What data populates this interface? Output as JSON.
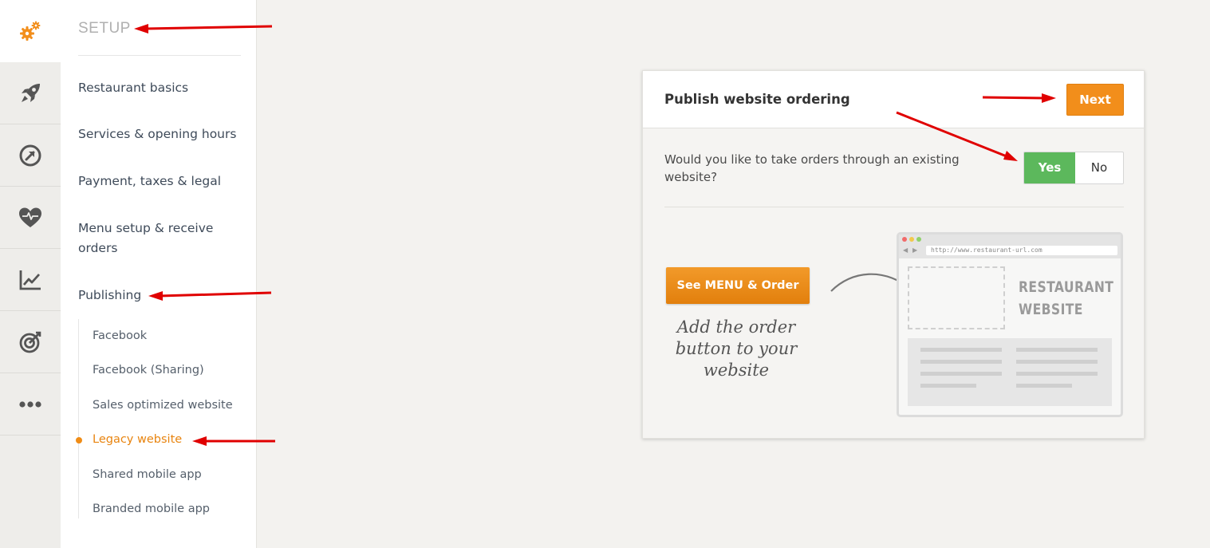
{
  "rail": {
    "items": [
      {
        "name": "setup-gears-icon",
        "active": true
      },
      {
        "name": "rocket-icon"
      },
      {
        "name": "growth-arrow-icon"
      },
      {
        "name": "health-heart-icon"
      },
      {
        "name": "analytics-chart-icon"
      },
      {
        "name": "target-icon"
      },
      {
        "name": "more-dots-icon"
      }
    ]
  },
  "sidebar": {
    "title": "SETUP",
    "items": [
      {
        "label": "Restaurant basics"
      },
      {
        "label": "Services & opening hours"
      },
      {
        "label": "Payment, taxes & legal"
      },
      {
        "label": "Menu setup & receive orders"
      },
      {
        "label": "Publishing"
      }
    ],
    "sub_items": [
      {
        "label": "Facebook"
      },
      {
        "label": "Facebook (Sharing)"
      },
      {
        "label": "Sales optimized website"
      },
      {
        "label": "Legacy website",
        "active": true
      },
      {
        "label": "Shared mobile app"
      },
      {
        "label": "Branded mobile app"
      }
    ]
  },
  "card": {
    "title": "Publish website ordering",
    "next_label": "Next",
    "question": "Would you like to take orders through an existing website?",
    "yes_label": "Yes",
    "no_label": "No",
    "selected": "Yes",
    "illustration": {
      "button_label": "See MENU & Order",
      "caption": "Add the order button to your website",
      "url": "http://www.restaurant-url.com",
      "site_title_line1": "RESTAURANT",
      "site_title_line2": "WEBSITE"
    }
  },
  "colors": {
    "accent_orange": "#f28e1b",
    "yes_green": "#5cb85c",
    "annotation_red": "#e00000"
  }
}
